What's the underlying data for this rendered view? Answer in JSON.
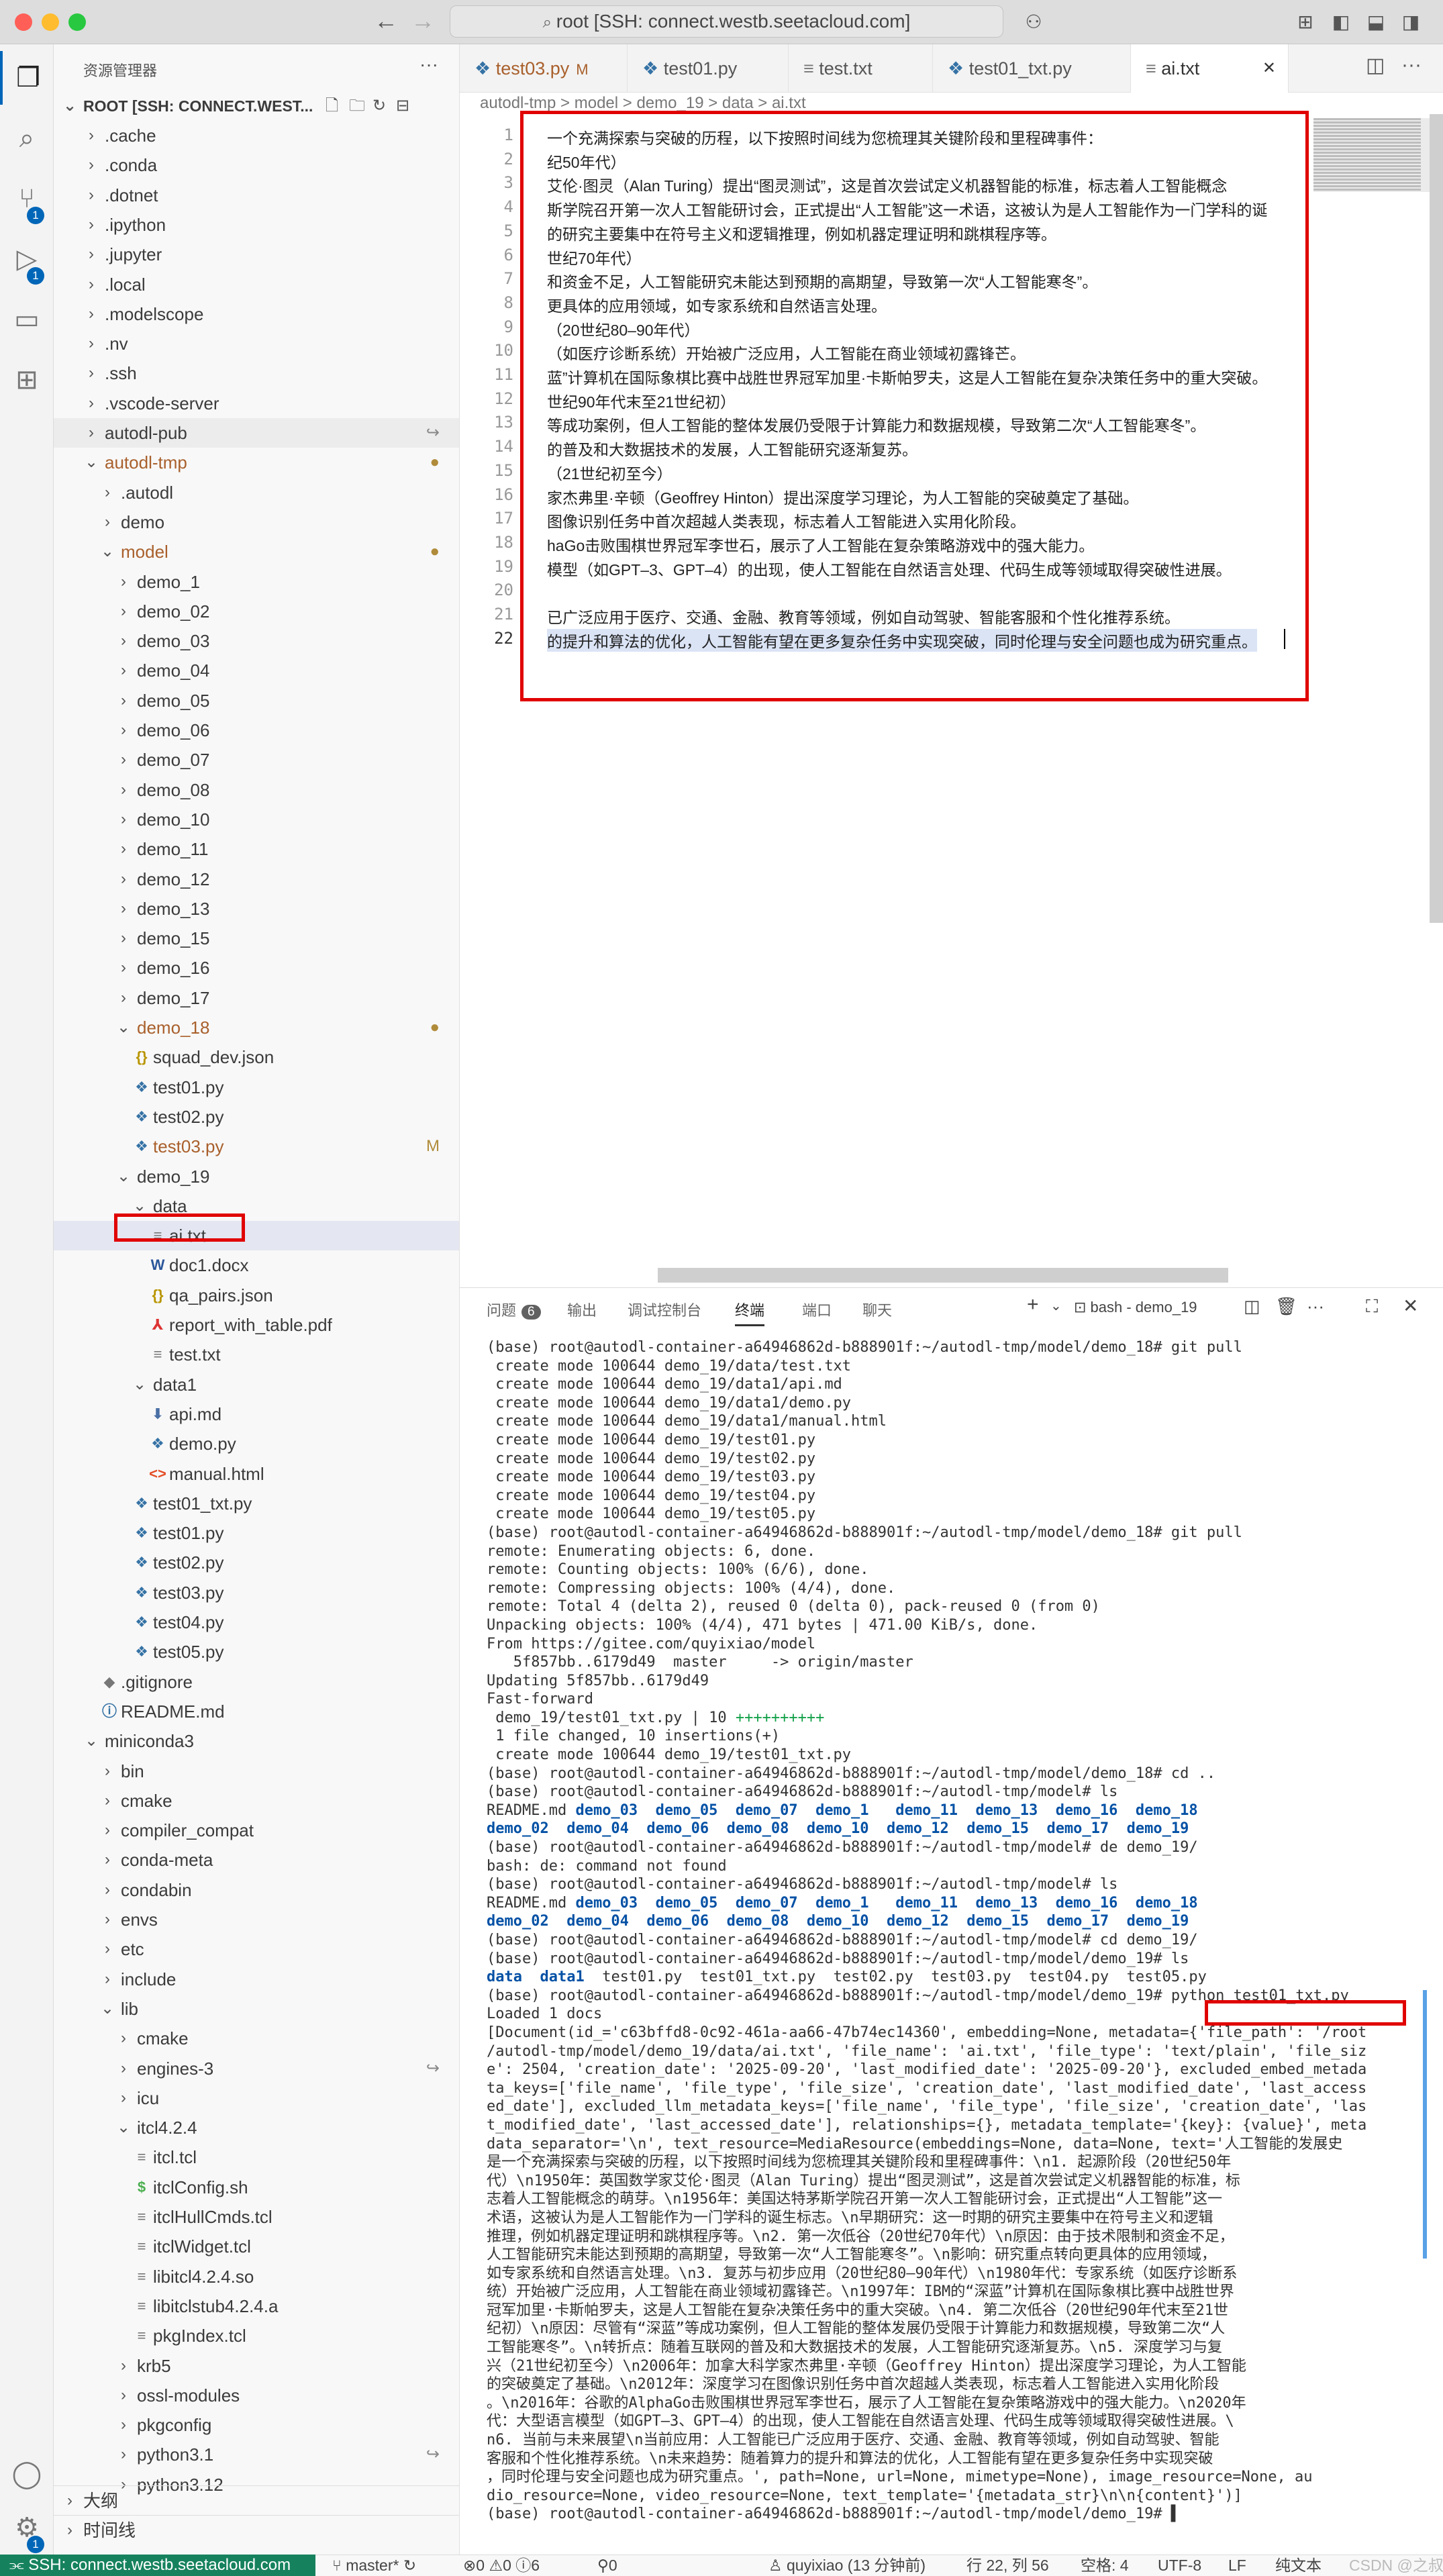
{
  "titlebar": {
    "address": "root [SSH: connect.westb.seetacloud.com]"
  },
  "colors": {
    "close": "#ff5f57",
    "minimize": "#febc2e",
    "maximize": "#28c840",
    "accent": "#0066b8",
    "annotation": "#e00000",
    "remote": "#16825d"
  },
  "activity": {
    "scm_badge": "1",
    "debug_badge": "1"
  },
  "sidebar": {
    "title": "资源管理器",
    "root": "ROOT [SSH: CONNECT.WEST...",
    "rows": [
      {
        "d": 1,
        "t": "f",
        "n": ".cache"
      },
      {
        "d": 1,
        "t": "f",
        "n": ".conda"
      },
      {
        "d": 1,
        "t": "f",
        "n": ".dotnet"
      },
      {
        "d": 1,
        "t": "f",
        "n": ".ipython"
      },
      {
        "d": 1,
        "t": "f",
        "n": ".jupyter"
      },
      {
        "d": 1,
        "t": "f",
        "n": ".local"
      },
      {
        "d": 1,
        "t": "f",
        "n": ".modelscope"
      },
      {
        "d": 1,
        "t": "f",
        "n": ".nv"
      },
      {
        "d": 1,
        "t": "f",
        "n": ".ssh"
      },
      {
        "d": 1,
        "t": "f",
        "n": ".vscode-server"
      },
      {
        "d": 1,
        "t": "f",
        "n": "autodl-pub",
        "deco": "↪",
        "bg": "#ececec"
      },
      {
        "d": 1,
        "t": "o",
        "n": "autodl-tmp",
        "c": "#a9602c",
        "deco": "●"
      },
      {
        "d": 2,
        "t": "f",
        "n": ".autodl"
      },
      {
        "d": 2,
        "t": "f",
        "n": "demo"
      },
      {
        "d": 2,
        "t": "o",
        "n": "model",
        "c": "#a9602c",
        "deco": "●"
      },
      {
        "d": 3,
        "t": "f",
        "n": "demo_1"
      },
      {
        "d": 3,
        "t": "f",
        "n": "demo_02"
      },
      {
        "d": 3,
        "t": "f",
        "n": "demo_03"
      },
      {
        "d": 3,
        "t": "f",
        "n": "demo_04"
      },
      {
        "d": 3,
        "t": "f",
        "n": "demo_05"
      },
      {
        "d": 3,
        "t": "f",
        "n": "demo_06"
      },
      {
        "d": 3,
        "t": "f",
        "n": "demo_07"
      },
      {
        "d": 3,
        "t": "f",
        "n": "demo_08"
      },
      {
        "d": 3,
        "t": "f",
        "n": "demo_10"
      },
      {
        "d": 3,
        "t": "f",
        "n": "demo_11"
      },
      {
        "d": 3,
        "t": "f",
        "n": "demo_12"
      },
      {
        "d": 3,
        "t": "f",
        "n": "demo_13"
      },
      {
        "d": 3,
        "t": "f",
        "n": "demo_15"
      },
      {
        "d": 3,
        "t": "f",
        "n": "demo_16"
      },
      {
        "d": 3,
        "t": "f",
        "n": "demo_17"
      },
      {
        "d": 3,
        "t": "o",
        "n": "demo_18",
        "c": "#a9602c",
        "deco": "●"
      },
      {
        "d": 4,
        "t": "j",
        "n": "squad_dev.json"
      },
      {
        "d": 4,
        "t": "p",
        "n": "test01.py"
      },
      {
        "d": 4,
        "t": "p",
        "n": "test02.py"
      },
      {
        "d": 4,
        "t": "p",
        "n": "test03.py",
        "c": "#a9602c",
        "deco": "M"
      },
      {
        "d": 3,
        "t": "o",
        "n": "demo_19"
      },
      {
        "d": 4,
        "t": "o",
        "n": "data"
      },
      {
        "d": 5,
        "t": "x",
        "n": "ai.txt",
        "sel": true
      },
      {
        "d": 5,
        "t": "w",
        "n": "doc1.docx"
      },
      {
        "d": 5,
        "t": "j",
        "n": "qa_pairs.json"
      },
      {
        "d": 5,
        "t": "pdf",
        "n": "report_with_table.pdf"
      },
      {
        "d": 5,
        "t": "x",
        "n": "test.txt"
      },
      {
        "d": 4,
        "t": "o",
        "n": "data1"
      },
      {
        "d": 5,
        "t": "md",
        "n": "api.md"
      },
      {
        "d": 5,
        "t": "p",
        "n": "demo.py"
      },
      {
        "d": 5,
        "t": "h",
        "n": "manual.html"
      },
      {
        "d": 4,
        "t": "p",
        "n": "test01_txt.py"
      },
      {
        "d": 4,
        "t": "p",
        "n": "test01.py"
      },
      {
        "d": 4,
        "t": "p",
        "n": "test02.py"
      },
      {
        "d": 4,
        "t": "p",
        "n": "test03.py"
      },
      {
        "d": 4,
        "t": "p",
        "n": "test04.py"
      },
      {
        "d": 4,
        "t": "p",
        "n": "test05.py"
      },
      {
        "d": 2,
        "t": "g",
        "n": ".gitignore"
      },
      {
        "d": 2,
        "t": "i",
        "n": "README.md"
      },
      {
        "d": 1,
        "t": "o",
        "n": "miniconda3"
      },
      {
        "d": 2,
        "t": "f",
        "n": "bin"
      },
      {
        "d": 2,
        "t": "f",
        "n": "cmake"
      },
      {
        "d": 2,
        "t": "f",
        "n": "compiler_compat"
      },
      {
        "d": 2,
        "t": "f",
        "n": "conda-meta"
      },
      {
        "d": 2,
        "t": "f",
        "n": "condabin"
      },
      {
        "d": 2,
        "t": "f",
        "n": "envs"
      },
      {
        "d": 2,
        "t": "f",
        "n": "etc"
      },
      {
        "d": 2,
        "t": "f",
        "n": "include"
      },
      {
        "d": 2,
        "t": "o",
        "n": "lib"
      },
      {
        "d": 3,
        "t": "f",
        "n": "cmake"
      },
      {
        "d": 3,
        "t": "f",
        "n": "engines-3",
        "deco": "↪"
      },
      {
        "d": 3,
        "t": "f",
        "n": "icu"
      },
      {
        "d": 3,
        "t": "o",
        "n": "itcl4.2.4"
      },
      {
        "d": 4,
        "t": "x",
        "n": "itcl.tcl"
      },
      {
        "d": 4,
        "t": "s",
        "n": "itclConfig.sh"
      },
      {
        "d": 4,
        "t": "x",
        "n": "itclHullCmds.tcl"
      },
      {
        "d": 4,
        "t": "x",
        "n": "itclWidget.tcl"
      },
      {
        "d": 4,
        "t": "x",
        "n": "libitcl4.2.4.so"
      },
      {
        "d": 4,
        "t": "x",
        "n": "libitclstub4.2.4.a"
      },
      {
        "d": 4,
        "t": "x",
        "n": "pkgIndex.tcl"
      },
      {
        "d": 3,
        "t": "f",
        "n": "krb5"
      },
      {
        "d": 3,
        "t": "f",
        "n": "ossl-modules"
      },
      {
        "d": 3,
        "t": "f",
        "n": "pkgconfig"
      },
      {
        "d": 3,
        "t": "f",
        "n": "python3.1",
        "deco": "↪"
      },
      {
        "d": 3,
        "t": "f",
        "n": "python3.12"
      }
    ],
    "outline": "大纲",
    "timeline": "时间线"
  },
  "tabs": [
    {
      "label": "test03.py",
      "mod": "M",
      "icon": "py",
      "c": "#a9602c"
    },
    {
      "label": "test01.py",
      "icon": "py"
    },
    {
      "label": "test.txt",
      "icon": "txt"
    },
    {
      "label": "test01_txt.py",
      "icon": "py"
    },
    {
      "label": "ai.txt",
      "icon": "txt",
      "active": true
    }
  ],
  "breadcrumb": "autodl-tmp > model > demo_19 > data > ai.txt",
  "code": [
    "一个充满探索与突破的历程，以下按照时间线为您梳理其关键阶段和里程碑事件：",
    "纪50年代）",
    "艾伦·图灵（Alan Turing）提出“图灵测试”，这是首次尝试定义机器智能的标准，标志着人工智能概念",
    "斯学院召开第一次人工智能研讨会，正式提出“人工智能”这一术语，这被认为是人工智能作为一门学科的诞",
    "的研究主要集中在符号主义和逻辑推理，例如机器定理证明和跳棋程序等。",
    "世纪70年代）",
    "和资金不足，人工智能研究未能达到预期的高期望，导致第一次“人工智能寒冬”。",
    "更具体的应用领域，如专家系统和自然语言处理。",
    "（20世纪80–90年代）",
    "（如医疗诊断系统）开始被广泛应用，人工智能在商业领域初露锋芒。",
    "蓝”计算机在国际象棋比赛中战胜世界冠军加里·卡斯帕罗夫，这是人工智能在复杂决策任务中的重大突破。",
    "世纪90年代末至21世纪初）",
    "等成功案例，但人工智能的整体发展仍受限于计算能力和数据规模，导致第二次“人工智能寒冬”。",
    "的普及和大数据技术的发展，人工智能研究逐渐复苏。",
    "（21世纪初至今）",
    "家杰弗里·辛顿（Geoffrey Hinton）提出深度学习理论，为人工智能的突破奠定了基础。",
    "图像识别任务中首次超越人类表现，标志着人工智能进入实用化阶段。",
    "haGo击败围棋世界冠军李世石，展示了人工智能在复杂策略游戏中的强大能力。",
    "模型（如GPT–3、GPT–4）的出现，使人工智能在自然语言处理、代码生成等领域取得突破性进展。",
    "",
    "已广泛应用于医疗、交通、金融、教育等领域，例如自动驾驶、智能客服和个性化推荐系统。",
    "的提升和算法的优化，人工智能有望在更多复杂任务中实现突破，同时伦理与安全问题也成为研究重点。"
  ],
  "panel": {
    "tabs": [
      "问题",
      "输出",
      "调试控制台",
      "终端",
      "端口",
      "聊天"
    ],
    "problems_count": "6",
    "active": "终端",
    "shell": "bash - demo_19"
  },
  "terminal": [
    {
      "t": "(base) root@autodl-container-a64946862d-b888901f:~/autodl-tmp/model/demo_18# git pull"
    },
    {
      "t": " create mode 100644 demo_19/data/test.txt"
    },
    {
      "t": " create mode 100644 demo_19/data1/api.md"
    },
    {
      "t": " create mode 100644 demo_19/data1/demo.py"
    },
    {
      "t": " create mode 100644 demo_19/data1/manual.html"
    },
    {
      "t": " create mode 100644 demo_19/test01.py"
    },
    {
      "t": " create mode 100644 demo_19/test02.py"
    },
    {
      "t": " create mode 100644 demo_19/test03.py"
    },
    {
      "t": " create mode 100644 demo_19/test04.py"
    },
    {
      "t": " create mode 100644 demo_19/test05.py"
    },
    {
      "t": "(base) root@autodl-container-a64946862d-b888901f:~/autodl-tmp/model/demo_18# git pull",
      "dot": "#1a85ff"
    },
    {
      "t": "remote: Enumerating objects: 6, done."
    },
    {
      "t": "remote: Counting objects: 100% (6/6), done."
    },
    {
      "t": "remote: Compressing objects: 100% (4/4), done."
    },
    {
      "t": "remote: Total 4 (delta 2), reused 0 (delta 0), pack-reused 0 (from 0)"
    },
    {
      "t": "Unpacking objects: 100% (4/4), 471 bytes | 471.00 KiB/s, done."
    },
    {
      "t": "From https://gitee.com/quyixiao/model"
    },
    {
      "t": "   5f857bb..6179d49  master     -> origin/master"
    },
    {
      "t": "Updating 5f857bb..6179d49"
    },
    {
      "t": "Fast-forward"
    },
    {
      "t": " demo_19/test01_txt.py | 10 ",
      "g": "++++++++++"
    },
    {
      "t": " 1 file changed, 10 insertions(+)"
    },
    {
      "t": " create mode 100644 demo_19/test01_txt.py"
    },
    {
      "t": "(base) root@autodl-container-a64946862d-b888901f:~/autodl-tmp/model/demo_18# cd ..",
      "dot": "#1a85ff"
    },
    {
      "t": "(base) root@autodl-container-a64946862d-b888901f:~/autodl-tmp/model# ls",
      "dot": "#1a85ff"
    },
    {
      "t": "README.md ",
      "b": "demo_03  demo_05  demo_07  demo_1   demo_11  demo_13  demo_16  demo_18"
    },
    {
      "t": "",
      "b": "demo_02  demo_04  demo_06  demo_08  demo_10  demo_12  demo_15  demo_17  demo_19"
    },
    {
      "t": "(base) root@autodl-container-a64946862d-b888901f:~/autodl-tmp/model# de demo_19/",
      "dot": "#e51400"
    },
    {
      "t": "bash: de: command not found"
    },
    {
      "t": "(base) root@autodl-container-a64946862d-b888901f:~/autodl-tmp/model# ls",
      "dot": "#1a85ff"
    },
    {
      "t": "README.md ",
      "b": "demo_03  demo_05  demo_07  demo_1   demo_11  demo_13  demo_16  demo_18"
    },
    {
      "t": "",
      "b": "demo_02  demo_04  demo_06  demo_08  demo_10  demo_12  demo_15  demo_17  demo_19"
    },
    {
      "t": "(base) root@autodl-container-a64946862d-b888901f:~/autodl-tmp/model# cd demo_19/",
      "dot": "#1a85ff"
    },
    {
      "t": "(base) root@autodl-container-a64946862d-b888901f:~/autodl-tmp/model/demo_19# ls",
      "dot": "#1a85ff"
    },
    {
      "t": "  test01.py  test01_txt.py  test02.py  test03.py  test04.py  test05.py",
      "b": "data  data1"
    },
    {
      "t": "(base) root@autodl-container-a64946862d-b888901f:~/autodl-tmp/model/demo_19# ",
      "cmd": "python test01_txt.py",
      "dot": "#1a85ff"
    },
    {
      "t": "Loaded 1 docs"
    },
    {
      "t": "[Document(id_='c63bffd8-0c92-461a-aa66-47b74ec14360', embedding=None, metadata={'file_path': '/root"
    },
    {
      "t": "/autodl-tmp/model/demo_19/data/ai.txt', 'file_name': 'ai.txt', 'file_type': 'text/plain', 'file_siz"
    },
    {
      "t": "e': 2504, 'creation_date': '2025-09-20', 'last_modified_date': '2025-09-20'}, excluded_embed_metada"
    },
    {
      "t": "ta_keys=['file_name', 'file_type', 'file_size', 'creation_date', 'last_modified_date', 'last_access"
    },
    {
      "t": "ed_date'], excluded_llm_metadata_keys=['file_name', 'file_type', 'file_size', 'creation_date', 'las"
    },
    {
      "t": "t_modified_date', 'last_accessed_date'], relationships={}, metadata_template='{key}: {value}', meta"
    },
    {
      "t": "data_separator='\\n', text_resource=MediaResource(embeddings=None, data=None, text='人工智能的发展史"
    },
    {
      "t": "是一个充满探索与突破的历程，以下按照时间线为您梳理其关键阶段和里程碑事件：\\n1. 起源阶段（20世纪50年"
    },
    {
      "t": "代）\\n1950年：英国数学家艾伦·图灵（Alan Turing）提出“图灵测试”，这是首次尝试定义机器智能的标准，标"
    },
    {
      "t": "志着人工智能概念的萌芽。\\n1956年：美国达特茅斯学院召开第一次人工智能研讨会，正式提出“人工智能”这一"
    },
    {
      "t": "术语，这被认为是人工智能作为一门学科的诞生标志。\\n早期研究：这一时期的研究主要集中在符号主义和逻辑"
    },
    {
      "t": "推理，例如机器定理证明和跳棋程序等。\\n2. 第一次低谷（20世纪70年代）\\n原因：由于技术限制和资金不足，"
    },
    {
      "t": "人工智能研究未能达到预期的高期望，导致第一次“人工智能寒冬”。\\n影响：研究重点转向更具体的应用领域，"
    },
    {
      "t": "如专家系统和自然语言处理。\\n3. 复苏与初步应用（20世纪80–90年代）\\n1980年代：专家系统（如医疗诊断系"
    },
    {
      "t": "统）开始被广泛应用，人工智能在商业领域初露锋芒。\\n1997年：IBM的“深蓝”计算机在国际象棋比赛中战胜世界"
    },
    {
      "t": "冠军加里·卡斯帕罗夫，这是人工智能在复杂决策任务中的重大突破。\\n4. 第二次低谷（20世纪90年代末至21世"
    },
    {
      "t": "纪初）\\n原因：尽管有“深蓝”等成功案例，但人工智能的整体发展仍受限于计算能力和数据规模，导致第二次“人"
    },
    {
      "t": "工智能寒冬”。\\n转折点：随着互联网的普及和大数据技术的发展，人工智能研究逐渐复苏。\\n5. 深度学习与复"
    },
    {
      "t": "兴（21世纪初至今）\\n2006年：加拿大科学家杰弗里·辛顿（Geoffrey Hinton）提出深度学习理论，为人工智能"
    },
    {
      "t": "的突破奠定了基础。\\n2012年：深度学习在图像识别任务中首次超越人类表现，标志着人工智能进入实用化阶段"
    },
    {
      "t": "。\\n2016年：谷歌的AlphaGo击败围棋世界冠军李世石，展示了人工智能在复杂策略游戏中的强大能力。\\n2020年"
    },
    {
      "t": "代：大型语言模型（如GPT–3、GPT–4）的出现，使人工智能在自然语言处理、代码生成等领域取得突破性进展。\\"
    },
    {
      "t": "n6. 当前与未来展望\\n当前应用：人工智能已广泛应用于医疗、交通、金融、教育等领域，例如自动驾驶、智能"
    },
    {
      "t": "客服和个性化推荐系统。\\n未来趋势：随着算力的提升和算法的优化，人工智能有望在更多复杂任务中实现突破"
    },
    {
      "t": "，同时伦理与安全问题也成为研究重点。', path=None, url=None, mimetype=None), image_resource=None, au"
    },
    {
      "t": "dio_resource=None, video_resource=None, text_template='{metadata_str}\\n\\n{content}')]"
    },
    {
      "t": "(base) root@autodl-container-a64946862d-b888901f:~/autodl-tmp/model/demo_19# ▌",
      "dot": "#888"
    }
  ],
  "status": {
    "remote": "SSH: connect.westb.seetacloud.com",
    "branch": "master*",
    "errors": "0",
    "warnings": "0",
    "info": "6",
    "ports": "0",
    "blame": "quyixiao (13 分钟前)",
    "position": "行 22, 列 56",
    "spaces": "空格: 4",
    "encoding": "UTF-8",
    "eol": "LF",
    "lang": "纯文本",
    "watermark": "CSDN @之叔"
  }
}
